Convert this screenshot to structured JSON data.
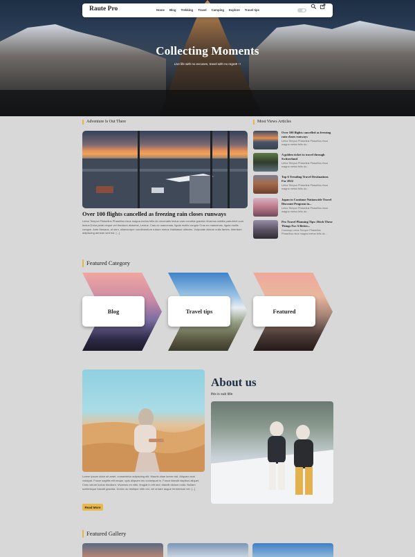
{
  "header": {
    "brand": "Raute Pro",
    "nav": [
      "Home",
      "Blog",
      "Trekking",
      "Travel",
      "Camping",
      "Explore",
      "Travel tips"
    ]
  },
  "hero": {
    "title": "Collecting Moments",
    "subtitle": "Live life with no excuses, travel with no regret! ! !"
  },
  "adventure": {
    "heading": "Adventure Is Out There",
    "title": "Over 100 flights cancelled as freezing rain closes runways",
    "body": "Letus Tempor Phasellus Phasellus risus magna metus felis do venenatis lectus cras conubia gravida Vivamus cubilia parturient cum lectus Dolor pede neque vel tincidunt dictumst, Lectus. Cras ex maecenas, ligula mollis congue Cras ex maecenas, ligula mollis congue. Ante thesaus, ut sem, ullamcorper condimentum rutrum metus Habitasse ultricies. Vulputate dictum nulla fames. Interdum adipiscing aenean sed est. [...]"
  },
  "most_viewed": {
    "heading": "Most Views Articles",
    "items": [
      {
        "title": "Over 100 flights cancelled as freezing rain closes runways",
        "excerpt": "Letus Tempor Phasellus Phasellus risus magna metus felis do..."
      },
      {
        "title": "A golden ticket to travel through Switzerland",
        "excerpt": "Letus Tempor Phasellus Phasellus risus magna metus felis do..."
      },
      {
        "title": "Top 6 Trending Travel Destinations For 2022",
        "excerpt": "Letus Tempor Phasellus Phasellus risus magna metus felis do..."
      },
      {
        "title": "Japan to Continue Nationwide Travel Discount Program in...",
        "excerpt": "Letus Tempor Phasellus Phasellus risus magna metus felis do..."
      },
      {
        "title": "Pro Travel Planning Tips: Ditch These Things For A Better...",
        "excerpt": "Consequ Letus Tempor Phasellus Phasellus risus magna metus felis do..."
      }
    ]
  },
  "featured_category": {
    "heading": "Featured Category",
    "items": [
      "Blog",
      "Travel tips",
      "Featured"
    ]
  },
  "about": {
    "title": "About us",
    "subtitle": "this is sub title",
    "body": "Lorem ipsum dolor sit amet, consectetur adipiscing elit. Mauris vitae lorem nisl. Aliquam erat volutpat. Fusce sagittis elit neque, quis aliquam leo consequat in. Fusce blandit dapibus aliquet. Cras rutrum luctus tincidunt. Vivamus mi nibh, feugiat in elit sed, blandit dictum nulla. Nullam scelerisque blandit gravida. Donec ac tristique nibh est, vel ornare augue fermentum vel. [...]",
    "button": "Read More"
  },
  "featured_gallery": {
    "heading": "Featured Gallery"
  },
  "colors": {
    "accent": "#e8b63b",
    "page_bg": "#d8d8d8"
  }
}
